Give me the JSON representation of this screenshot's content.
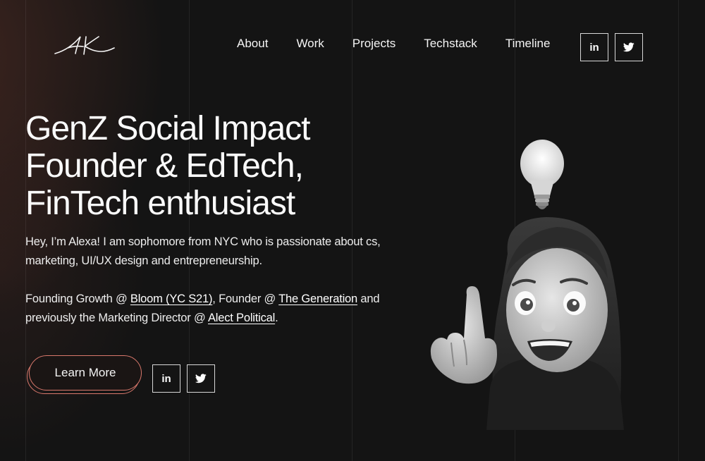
{
  "logo": {
    "text": "AK"
  },
  "nav": {
    "items": [
      {
        "label": "About"
      },
      {
        "label": "Work"
      },
      {
        "label": "Projects"
      },
      {
        "label": "Techstack"
      },
      {
        "label": "Timeline"
      }
    ]
  },
  "social": {
    "linkedin_label": "in",
    "twitter_icon": "twitter-icon"
  },
  "hero": {
    "headline_lines": [
      "GenZ Social Impact",
      "Founder & EdTech,",
      "FinTech enthusiast"
    ],
    "intro": "Hey, I’m Alexa! I am sophomore from NYC who is passionate about cs, marketing, UI/UX design and entrepreneurship.",
    "roles": {
      "p1": "Founding Growth @ ",
      "link1": "Bloom (YC S21)",
      "p2": ", Founder @ ",
      "link2": "The Generation",
      "p3": " and previously the Marketing Director @ ",
      "link3": "Alect Political",
      "p4": "."
    },
    "cta_label": "Learn More"
  },
  "colors": {
    "accent": "#d9786c",
    "background": "#141414",
    "text": "#f2f2f2"
  }
}
